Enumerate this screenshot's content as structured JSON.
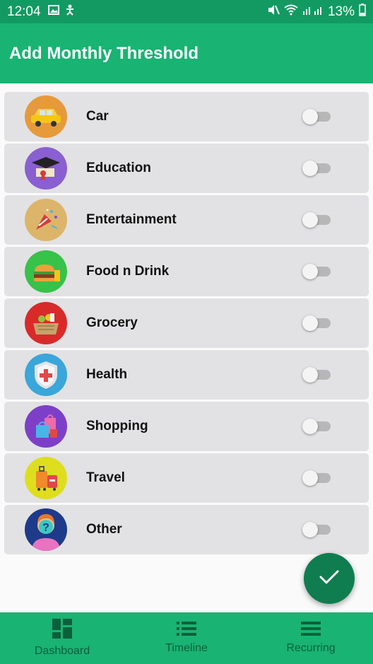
{
  "status_bar": {
    "time": "12:04",
    "battery": "13%",
    "icons": [
      "image-icon",
      "accessibility-icon",
      "mute-icon",
      "wifi-icon",
      "signal-icon",
      "battery-icon"
    ]
  },
  "app_bar": {
    "title": "Add Monthly Threshold"
  },
  "categories": [
    {
      "label": "Car",
      "icon": "car-icon",
      "color": "#e69a3a",
      "enabled": false
    },
    {
      "label": "Education",
      "icon": "graduation-cap-icon",
      "color": "#8a5fd1",
      "enabled": false
    },
    {
      "label": "Entertainment",
      "icon": "party-popper-icon",
      "color": "#dcb56a",
      "enabled": false
    },
    {
      "label": "Food n Drink",
      "icon": "burger-icon",
      "color": "#37c24a",
      "enabled": false
    },
    {
      "label": "Grocery",
      "icon": "basket-icon",
      "color": "#d92a2a",
      "enabled": false
    },
    {
      "label": "Health",
      "icon": "shield-cross-icon",
      "color": "#3aa6d9",
      "enabled": false
    },
    {
      "label": "Shopping",
      "icon": "shopping-bags-icon",
      "color": "#7d3fc8",
      "enabled": false
    },
    {
      "label": "Travel",
      "icon": "luggage-icon",
      "color": "#dede1e",
      "enabled": false
    },
    {
      "label": "Other",
      "icon": "question-person-icon",
      "color": "#1e3a8a",
      "enabled": false
    }
  ],
  "fab": {
    "icon": "check-icon"
  },
  "bottom_nav": [
    {
      "label": "Dashboard",
      "icon": "dashboard-icon"
    },
    {
      "label": "Timeline",
      "icon": "list-icon"
    },
    {
      "label": "Recurring",
      "icon": "menu-icon"
    }
  ],
  "colors": {
    "primary": "#19b373",
    "primary_dark": "#129a62",
    "fab": "#0f7d4f",
    "row_bg": "#e2e2e4"
  }
}
